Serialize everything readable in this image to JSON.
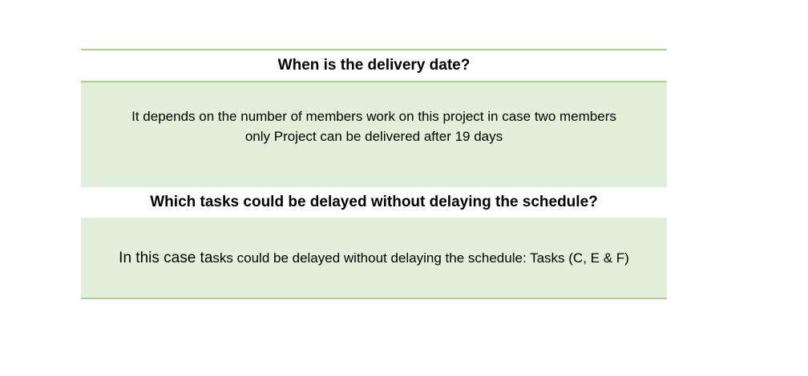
{
  "qa": [
    {
      "question": "When is the delivery date?",
      "answer_line1": "It depends on the number of members work on this project in case two members",
      "answer_line2": "only Project can be delivered after 19 days"
    },
    {
      "question": "Which tasks could be delayed without delaying the schedule?",
      "answer_lead": "In this case ta",
      "answer_rest": "sks could be delayed without delaying the schedule: Tasks (C, E & F)"
    }
  ],
  "colors": {
    "border": "#a9d08e",
    "answer_background": "#e2efda"
  }
}
